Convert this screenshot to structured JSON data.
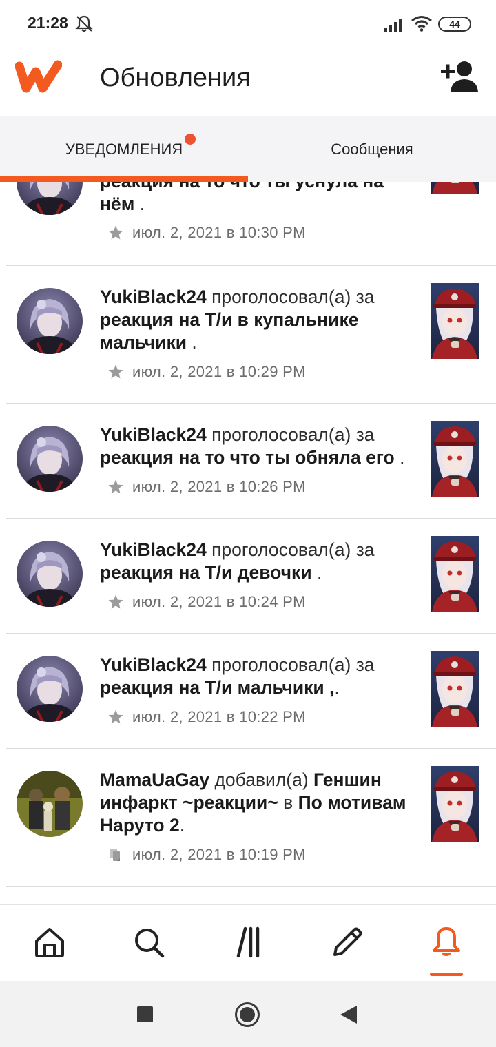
{
  "status_bar": {
    "time": "21:28",
    "battery": "44"
  },
  "header": {
    "title": "Обновления"
  },
  "tabs": [
    {
      "label": "УВЕДОМЛЕНИЯ",
      "active": true,
      "has_badge": true
    },
    {
      "label": "Сообщения",
      "active": false
    }
  ],
  "notifications": [
    {
      "user": "",
      "verb": "",
      "story": "реакция на то что ты уснула на нём",
      "suffix": " .",
      "time": "июл. 2, 2021 в 10:30 PM",
      "icon": "star-icon"
    },
    {
      "user": "YukiBlack24",
      "verb": " проголосовал(а) за ",
      "story": "реакция на Т/и в купальнике мальчики",
      "suffix": " .",
      "time": "июл. 2, 2021 в 10:29 PM",
      "icon": "star-icon"
    },
    {
      "user": "YukiBlack24",
      "verb": " проголосовал(а) за ",
      "story": "реакция на то что ты обняла его",
      "suffix": " .",
      "time": "июл. 2, 2021 в 10:26 PM",
      "icon": "star-icon"
    },
    {
      "user": "YukiBlack24",
      "verb": " проголосовал(а) за ",
      "story": "реакция на Т/и девочки",
      "suffix": " .",
      "time": "июл. 2, 2021 в 10:24 PM",
      "icon": "star-icon"
    },
    {
      "user": "YukiBlack24",
      "verb": " проголосовал(а) за ",
      "story": "реакция на Т/и мальчики ,",
      "suffix": ".",
      "time": "июл. 2, 2021 в 10:22 PM",
      "icon": "star-icon"
    },
    {
      "user": "MamaUaGay",
      "verb": " добавил(а) ",
      "story": "Геншин инфаркт ~реакции~",
      "verb2": " в ",
      "story2": "По мотивам Наруто 2",
      "suffix": ".",
      "time": "июл. 2, 2021 в 10:19 PM",
      "icon": "reading-list-icon"
    }
  ],
  "bottom_nav": [
    {
      "name": "home-icon",
      "active": false
    },
    {
      "name": "search-icon",
      "active": false
    },
    {
      "name": "library-icon",
      "active": false
    },
    {
      "name": "write-icon",
      "active": false
    },
    {
      "name": "notifications-icon",
      "active": true
    }
  ],
  "colors": {
    "accent": "#f25a1f",
    "badge": "#ee5233",
    "tab_bar": "#f4f3f5",
    "meta_text": "#6c6c6c"
  }
}
